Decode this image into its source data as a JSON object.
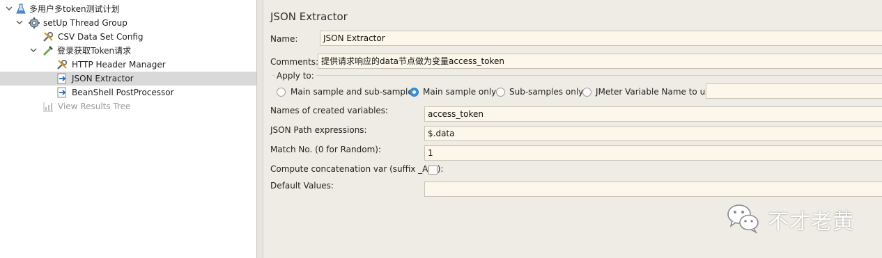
{
  "tree": {
    "items": [
      {
        "label": "多用户多token测试计划",
        "icon": "flask-icon",
        "toggle": "chevron-down"
      },
      {
        "label": "setUp Thread Group",
        "icon": "gear-icon",
        "toggle": "chevron-down"
      },
      {
        "label": "CSV Data Set Config",
        "icon": "wrench-icon"
      },
      {
        "label": "登录获取Token请求",
        "icon": "pipette-icon",
        "toggle": "chevron-down"
      },
      {
        "label": "HTTP Header Manager",
        "icon": "wrench-icon"
      },
      {
        "label": "JSON Extractor",
        "icon": "post-processor-icon",
        "selected": true
      },
      {
        "label": "BeanShell PostProcessor",
        "icon": "post-processor-icon"
      },
      {
        "label": "View Results Tree",
        "icon": "chart-icon",
        "disabled": true
      }
    ]
  },
  "panel": {
    "title": "JSON Extractor",
    "name_label": "Name:",
    "name_value": "JSON Extractor",
    "comments_label": "Comments:",
    "comments_value": "提供请求响应的data节点做为变量access_token",
    "apply_to": {
      "legend": "Apply to:",
      "options": [
        {
          "label": "Main sample and sub-samples",
          "selected": false
        },
        {
          "label": "Main sample only",
          "selected": true
        },
        {
          "label": "Sub-samples only",
          "selected": false
        },
        {
          "label": "JMeter Variable Name to use",
          "selected": false
        }
      ],
      "variable_value": ""
    },
    "fields": {
      "names_label": "Names of created variables:",
      "names_value": "access_token",
      "paths_label": "JSON Path expressions:",
      "paths_value": "$.data",
      "match_label": "Match No. (0 for Random):",
      "match_value": "1",
      "concat_label": "Compute concatenation var (suffix _ALL):",
      "concat_checked": false,
      "default_label": "Default Values:",
      "default_value": ""
    }
  },
  "watermark": {
    "text": "不才老黄",
    "icon": "wechat-icon"
  },
  "colors": {
    "selection": "#d9d9d9",
    "field_bg": "#fcf7ea",
    "panel_bg": "#eeece4",
    "radio_accent": "#3d8fd6"
  }
}
